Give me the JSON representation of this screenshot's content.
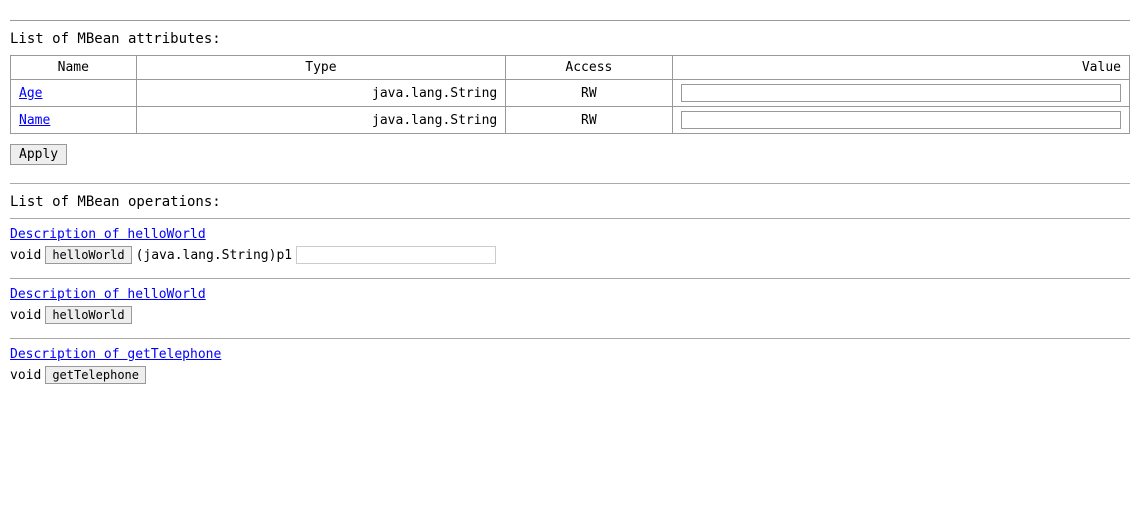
{
  "attributes": {
    "section_title": "List of MBean attributes:",
    "columns": {
      "name": "Name",
      "type": "Type",
      "access": "Access",
      "value": "Value"
    },
    "rows": [
      {
        "name": "Age",
        "type": "java.lang.String",
        "access": "RW",
        "value": ""
      },
      {
        "name": "Name",
        "type": "java.lang.String",
        "access": "RW",
        "value": ""
      }
    ],
    "apply_label": "Apply"
  },
  "operations": {
    "section_title": "List of MBean operations:",
    "items": [
      {
        "description": "Description of helloWorld",
        "return_type": "void",
        "method_name": "helloWorld",
        "params": "(java.lang.String)p1",
        "has_input": true
      },
      {
        "description": "Description of helloWorld",
        "return_type": "void",
        "method_name": "helloWorld",
        "params": "",
        "has_input": false
      },
      {
        "description": "Description of getTelephone",
        "return_type": "void",
        "method_name": "getTelephone",
        "params": "",
        "has_input": false
      }
    ]
  }
}
